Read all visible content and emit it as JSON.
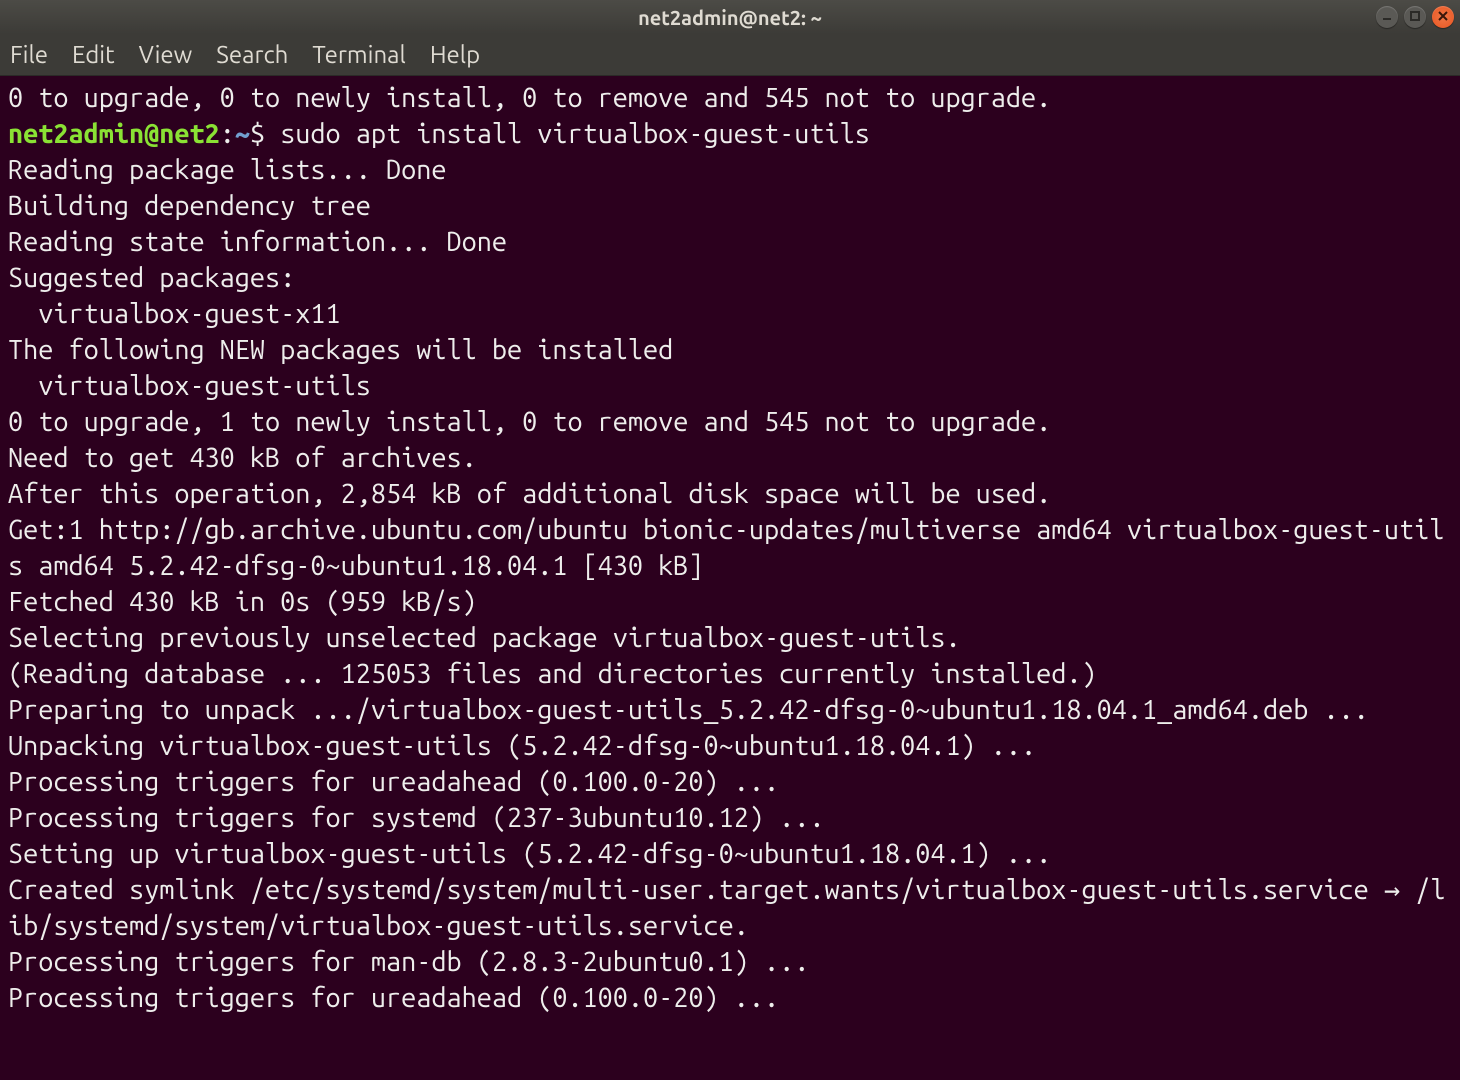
{
  "titlebar": {
    "title": "net2admin@net2: ~"
  },
  "menubar": {
    "items": [
      "File",
      "Edit",
      "View",
      "Search",
      "Terminal",
      "Help"
    ]
  },
  "prompt": {
    "user_host": "net2admin@net2",
    "sep": ":",
    "path": "~",
    "symbol": "$"
  },
  "terminal": {
    "pre_prompt_line": "0 to upgrade, 0 to newly install, 0 to remove and 545 not to upgrade.",
    "command": "sudo apt install virtualbox-guest-utils",
    "output_lines": [
      "Reading package lists... Done",
      "Building dependency tree",
      "Reading state information... Done",
      "Suggested packages:",
      "  virtualbox-guest-x11",
      "The following NEW packages will be installed",
      "  virtualbox-guest-utils",
      "0 to upgrade, 1 to newly install, 0 to remove and 545 not to upgrade.",
      "Need to get 430 kB of archives.",
      "After this operation, 2,854 kB of additional disk space will be used.",
      "Get:1 http://gb.archive.ubuntu.com/ubuntu bionic-updates/multiverse amd64 virtualbox-guest-utils amd64 5.2.42-dfsg-0~ubuntu1.18.04.1 [430 kB]",
      "Fetched 430 kB in 0s (959 kB/s)",
      "Selecting previously unselected package virtualbox-guest-utils.",
      "(Reading database ... 125053 files and directories currently installed.)",
      "Preparing to unpack .../virtualbox-guest-utils_5.2.42-dfsg-0~ubuntu1.18.04.1_amd64.deb ...",
      "Unpacking virtualbox-guest-utils (5.2.42-dfsg-0~ubuntu1.18.04.1) ...",
      "Processing triggers for ureadahead (0.100.0-20) ...",
      "Processing triggers for systemd (237-3ubuntu10.12) ...",
      "Setting up virtualbox-guest-utils (5.2.42-dfsg-0~ubuntu1.18.04.1) ...",
      "Created symlink /etc/systemd/system/multi-user.target.wants/virtualbox-guest-utils.service → /lib/systemd/system/virtualbox-guest-utils.service.",
      "Processing triggers for man-db (2.8.3-2ubuntu0.1) ...",
      "Processing triggers for ureadahead (0.100.0-20) ..."
    ]
  }
}
